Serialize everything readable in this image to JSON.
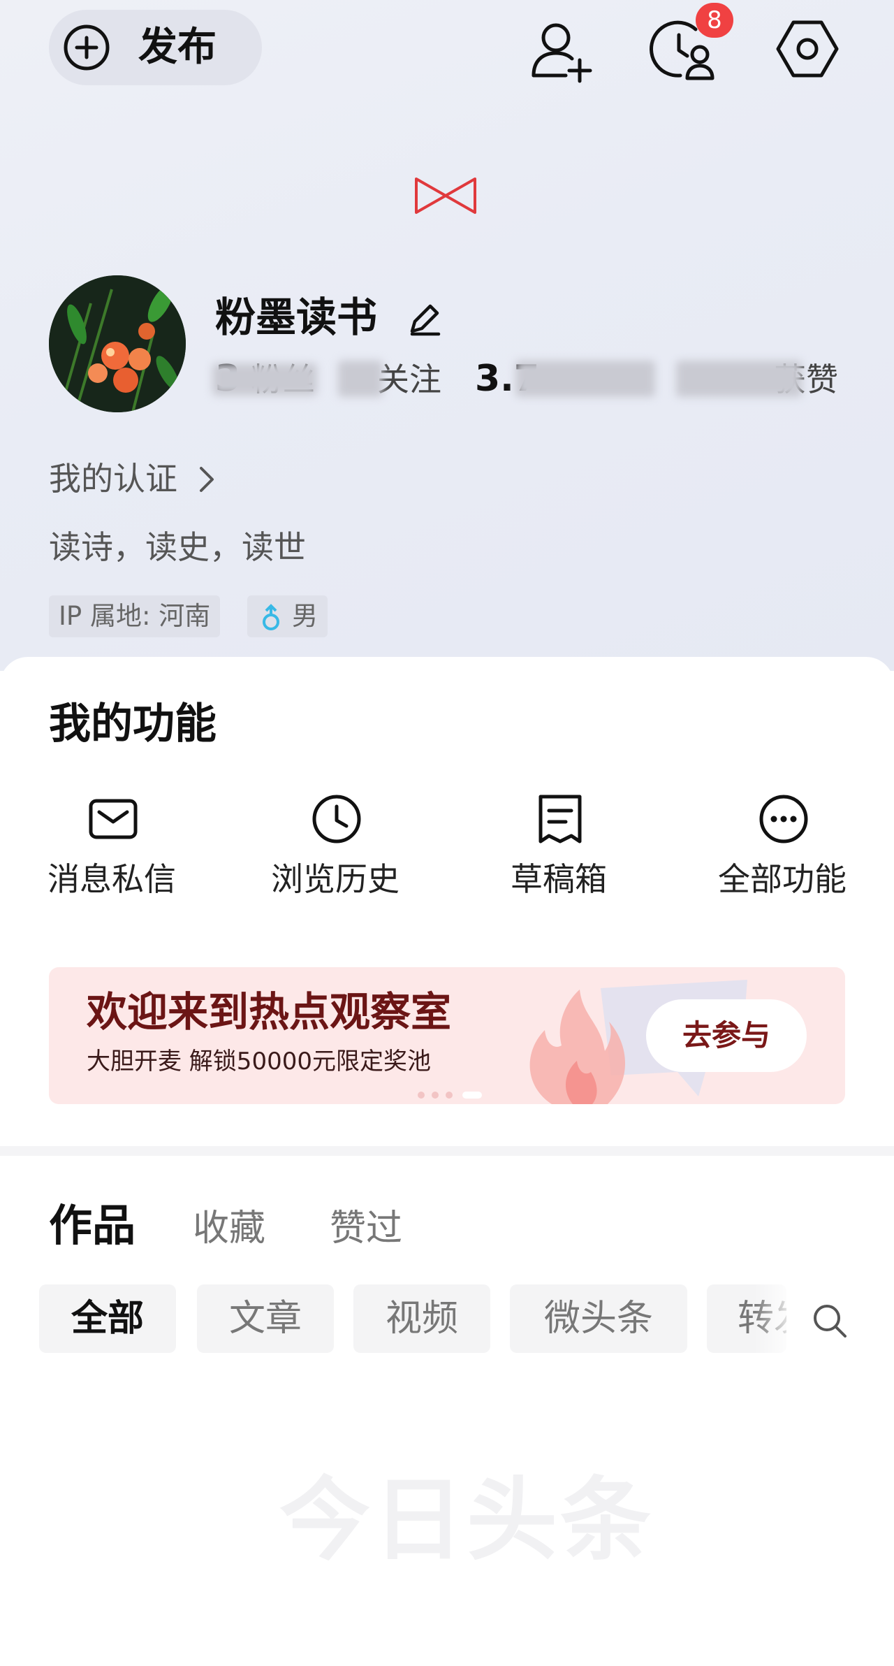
{
  "header": {
    "publish_label": "发布",
    "notification_count": "8",
    "icons": [
      "plus-circle-icon",
      "add-friend-icon",
      "history-user-icon",
      "settings-hexagon-icon"
    ]
  },
  "profile": {
    "nickname": "粉墨读书",
    "stats": [
      {
        "value": "3",
        "label": "粉丝"
      },
      {
        "value": "",
        "label": "关注"
      },
      {
        "value": "3.7",
        "label": ""
      },
      {
        "value": "",
        "label": "获赞"
      }
    ],
    "verify_label": "我的认证",
    "bio": "读诗，读史，读世",
    "ip_tag": "IP 属地: 河南",
    "gender_tag": "男"
  },
  "functions": {
    "title": "我的功能",
    "items": [
      {
        "label": "消息私信",
        "icon": "mail-icon"
      },
      {
        "label": "浏览历史",
        "icon": "clock-icon"
      },
      {
        "label": "草稿箱",
        "icon": "draft-icon"
      },
      {
        "label": "全部功能",
        "icon": "more-icon"
      }
    ]
  },
  "banner": {
    "title": "欢迎来到热点观察室",
    "subtitle": "大胆开麦 解锁50000元限定奖池",
    "cta": "去参与"
  },
  "content_tabs": [
    "作品",
    "收藏",
    "赞过"
  ],
  "filter_chips": [
    "全部",
    "文章",
    "视频",
    "微头条",
    "转发"
  ],
  "watermark": "今日头条",
  "colors": {
    "accent_red": "#f04142",
    "banner_bg": "#fde8e8",
    "banner_text": "#6b1515",
    "gender_male": "#38b9e6"
  }
}
